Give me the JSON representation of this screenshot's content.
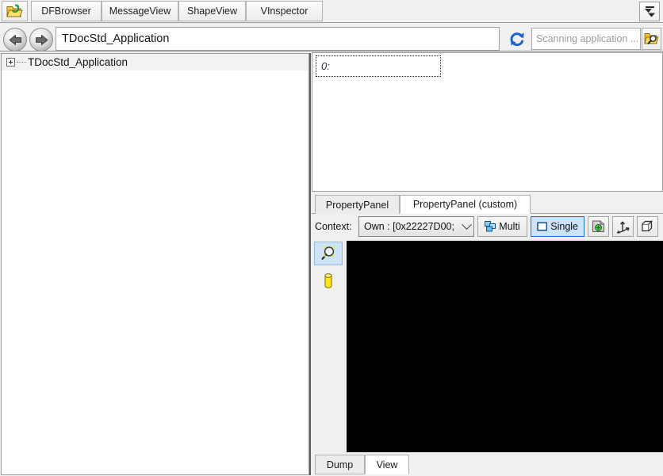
{
  "window": {
    "title": "TDocStd_Application"
  },
  "toolbar": {
    "folder_icon": "open-folder-refresh-icon",
    "tabs": [
      {
        "label": "DFBrowser",
        "active": false
      },
      {
        "label": "MessageView",
        "active": false
      },
      {
        "label": "ShapeView",
        "active": false
      },
      {
        "label": "VInspector",
        "active": false
      }
    ],
    "overflow_icon": "tab-overflow-icon"
  },
  "address": {
    "back_icon": "back-arrow-icon",
    "forward_icon": "forward-arrow-icon",
    "value": "TDocStd_Application",
    "refresh_icon": "refresh-icon"
  },
  "search": {
    "placeholder": "Scanning application ...",
    "value": "",
    "button_icon": "folder-search-icon"
  },
  "tree": {
    "items": [
      {
        "label": "TDocStd_Application",
        "expanded": false,
        "selected": true
      }
    ]
  },
  "property_panel": {
    "header_cell": "0:",
    "tabs": [
      {
        "label": "PropertyPanel",
        "active": false
      },
      {
        "label": "PropertyPanel (custom)",
        "active": true
      }
    ]
  },
  "context_toolbar": {
    "label": "Context:",
    "selected_context": "Own : [0x22227D00;",
    "dropdown_icon": "chevron-down-icon",
    "multi_label": "Multi",
    "multi_icon": "multi-select-icon",
    "multi_checked": false,
    "single_label": "Single",
    "single_icon": "single-select-icon",
    "single_checked": true,
    "icon_buttons": [
      {
        "icon": "display-mode-icon"
      },
      {
        "icon": "trihedron-axis-icon"
      },
      {
        "icon": "bounding-box-icon"
      }
    ]
  },
  "view_sidebar": {
    "buttons": [
      {
        "icon": "fit-all-icon",
        "active": true
      },
      {
        "icon": "cylinder-icon",
        "active": false
      }
    ]
  },
  "viewport": {
    "background_color": "#000000"
  },
  "bottom_tabs": [
    {
      "label": "Dump",
      "active": false
    },
    {
      "label": "View",
      "active": true
    }
  ],
  "colors": {
    "accent": "#1c6ec4",
    "highlight": "#cde3f7",
    "panel_bg": "#f0f0f0",
    "white": "#ffffff",
    "viewport": "#000000"
  }
}
